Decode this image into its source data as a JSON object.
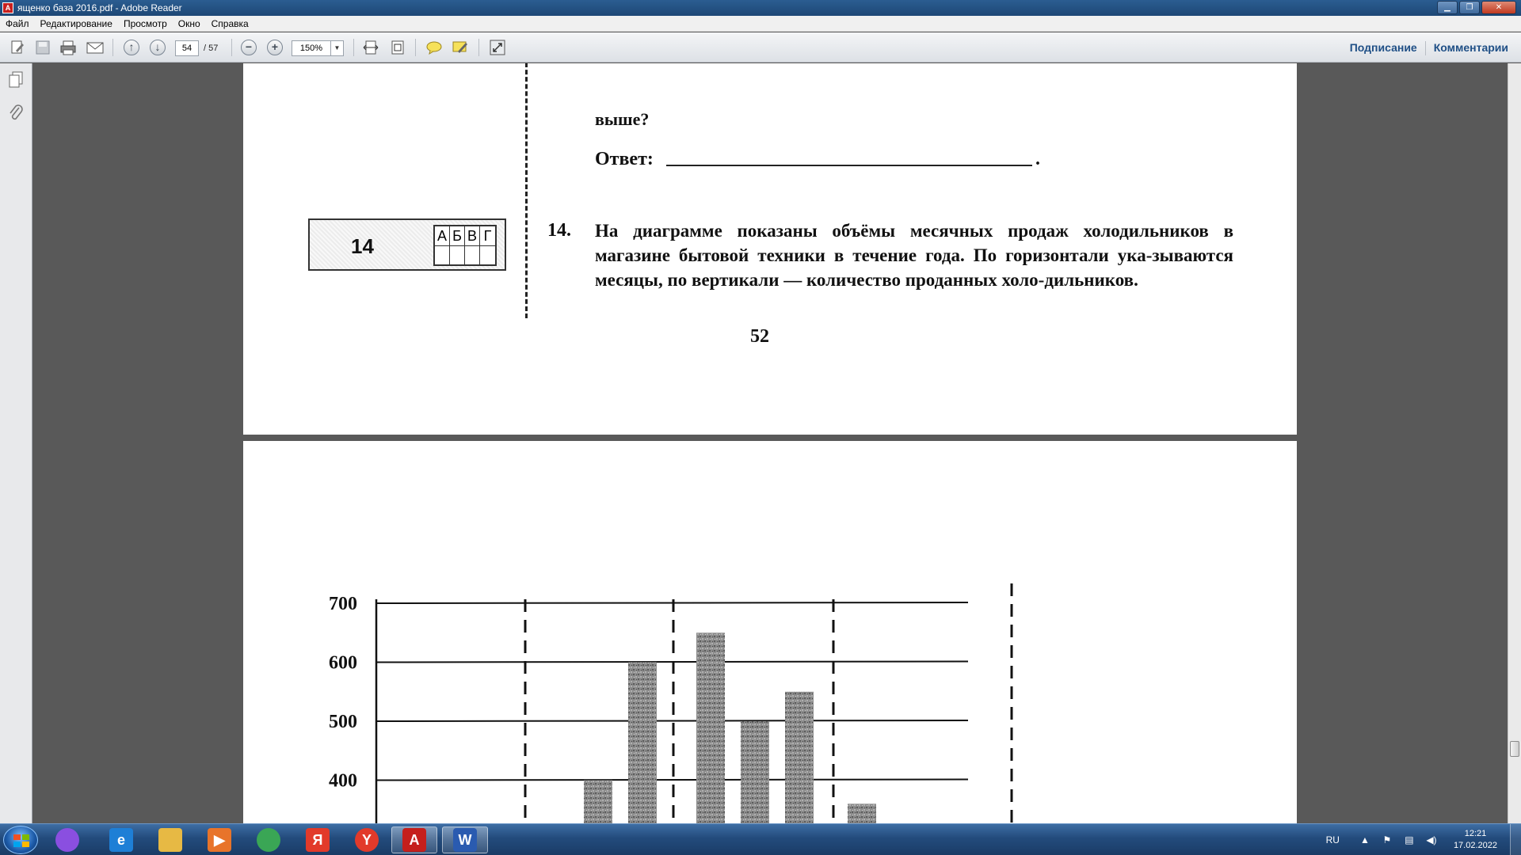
{
  "window": {
    "title": "ященко база 2016.pdf - Adobe Reader",
    "app_icon": "adobe-reader-icon",
    "controls": [
      "minimize",
      "maximize",
      "close"
    ]
  },
  "menu": [
    "Файл",
    "Редактирование",
    "Просмотр",
    "Окно",
    "Справка"
  ],
  "toolbar": {
    "current_page": "54",
    "total_pages": "/ 57",
    "zoom": "150%",
    "right_links": [
      "Подписание",
      "Комментарии"
    ]
  },
  "document": {
    "page_top": {
      "q13_tail": "выше?",
      "answer_label": "Ответ:",
      "answer_dot": ".",
      "answer_box": {
        "number": "14",
        "letters": [
          "А",
          "Б",
          "В",
          "Г"
        ]
      },
      "q14_number": "14.",
      "q14_text": "На диаграмме показаны объёмы месячных продаж холодильников в магазине бытовой техники в течение года. По горизонтали ука-зываются месяцы, по вертикали — количество проданных холо-дильников.",
      "page_number": "52"
    },
    "page_bottom": {
      "chart_data": {
        "type": "bar",
        "title": "",
        "xlabel": "",
        "ylabel": "",
        "y_ticks": [
          "700",
          "600",
          "500",
          "400"
        ],
        "ylim_visible": [
          350,
          700
        ],
        "values_visible": [
          400,
          600,
          650,
          500,
          550,
          360
        ],
        "grid": true,
        "note": "chart cut off at the bottom of the viewport; only upper part visible"
      }
    }
  },
  "taskbar": {
    "items": [
      {
        "name": "alice-icon",
        "color": "#8a4fe0",
        "glyph": ""
      },
      {
        "name": "internet-explorer-icon",
        "color": "#1e7fd6",
        "glyph": "e"
      },
      {
        "name": "file-explorer-icon",
        "color": "#e7b944",
        "glyph": ""
      },
      {
        "name": "media-player-icon",
        "color": "#e8742a",
        "glyph": "▶"
      },
      {
        "name": "chrome-icon",
        "color": "#3aa655",
        "glyph": ""
      },
      {
        "name": "yandex-icon",
        "color": "#e23a2a",
        "glyph": "Я"
      },
      {
        "name": "yandex-browser-icon",
        "color": "#e23a2a",
        "glyph": "Y"
      },
      {
        "name": "adobe-reader-icon",
        "color": "#c51f1c",
        "glyph": "A"
      },
      {
        "name": "word-icon",
        "color": "#2a5bb0",
        "glyph": "W"
      }
    ],
    "tray": {
      "lang": "RU",
      "time": "12:21",
      "date": "17.02.2022"
    }
  }
}
